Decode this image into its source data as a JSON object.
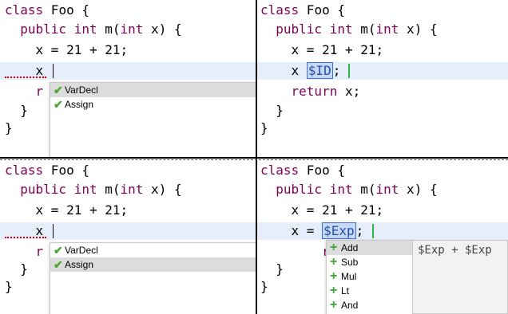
{
  "panels": {
    "top_left": {
      "lines": [
        "class Foo {",
        "  public int m(int x) {",
        "    x = 21 + 21;",
        "    x",
        "    r",
        "  }",
        "}"
      ],
      "popup": [
        "VarDecl",
        "Assign"
      ]
    },
    "top_right": {
      "lines": [
        "class Foo {",
        "  public int m(int x) {",
        "    x = 21 + 21;",
        "    x ",
        "    return x;",
        "  }",
        "}"
      ],
      "placeholder": "$ID",
      "after": ";"
    },
    "bottom_left": {
      "lines": [
        "class Foo {",
        "  public int m(int x) {",
        "    x = 21 + 21;",
        "    x",
        "    r",
        "  }",
        "}"
      ],
      "popup": [
        "VarDecl",
        "Assign"
      ]
    },
    "bottom_right": {
      "lines": [
        "class Foo {",
        "  public int m(int x) {",
        "    x = 21 + 21;",
        "    x = ",
        "    retu",
        "  }",
        "}"
      ],
      "placeholder": "$Exp",
      "after": ";",
      "popup": [
        "Add",
        "Sub",
        "Mul",
        "Lt",
        "And"
      ],
      "description": "$Exp + $Exp"
    }
  },
  "colors": {
    "keyword": "#7f0055",
    "check": "#4aa832",
    "plus": "#3fa33b",
    "highlight": "#e6eefc"
  },
  "icons": {
    "check": "check-icon",
    "plus": "plus-icon"
  }
}
